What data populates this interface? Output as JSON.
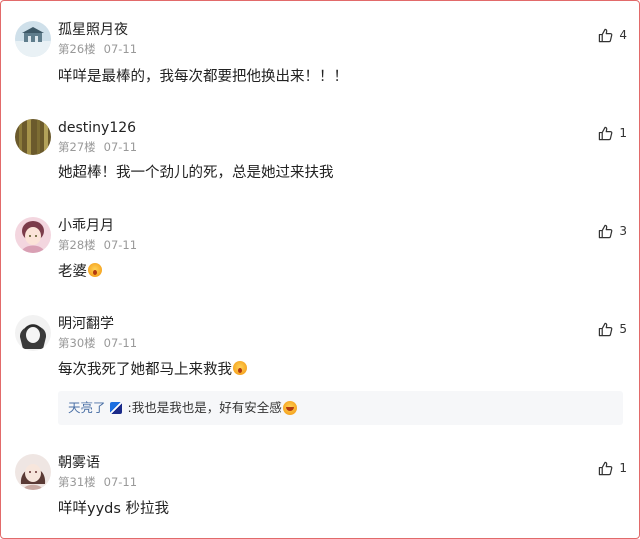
{
  "comments": [
    {
      "username": "孤星照月夜",
      "floor": "第26楼",
      "date": "07-11",
      "likes": "4",
      "text": "咩咩是最棒的，我每次都要把他换出来！！！"
    },
    {
      "username": "destiny126",
      "floor": "第27楼",
      "date": "07-11",
      "likes": "1",
      "text": "她超棒！我一个劲儿的死，总是她过来扶我"
    },
    {
      "username": "小乖月月",
      "floor": "第28楼",
      "date": "07-11",
      "likes": "3",
      "text": "老婆"
    },
    {
      "username": "明河翻学",
      "floor": "第30楼",
      "date": "07-11",
      "likes": "5",
      "text": "每次我死了她都马上来救我",
      "reply": {
        "name": "天亮了",
        "text": ":我也是我也是，好有安全感"
      }
    },
    {
      "username": "朝雾语",
      "floor": "第31楼",
      "date": "07-11",
      "likes": "1",
      "text": "咩咩yyds 秒拉我"
    }
  ],
  "icons": {
    "like": "thumbs-up-icon",
    "emoji_shock": "surprised-emoji-icon",
    "emoji_laugh": "laughing-emoji-icon",
    "badge": "user-badge-icon"
  },
  "colors": {
    "frame_border": "#e26a6a",
    "username": "#222222",
    "meta": "#999999",
    "reply_name": "#4a6fa5",
    "reply_bg": "#f6f7f9"
  }
}
